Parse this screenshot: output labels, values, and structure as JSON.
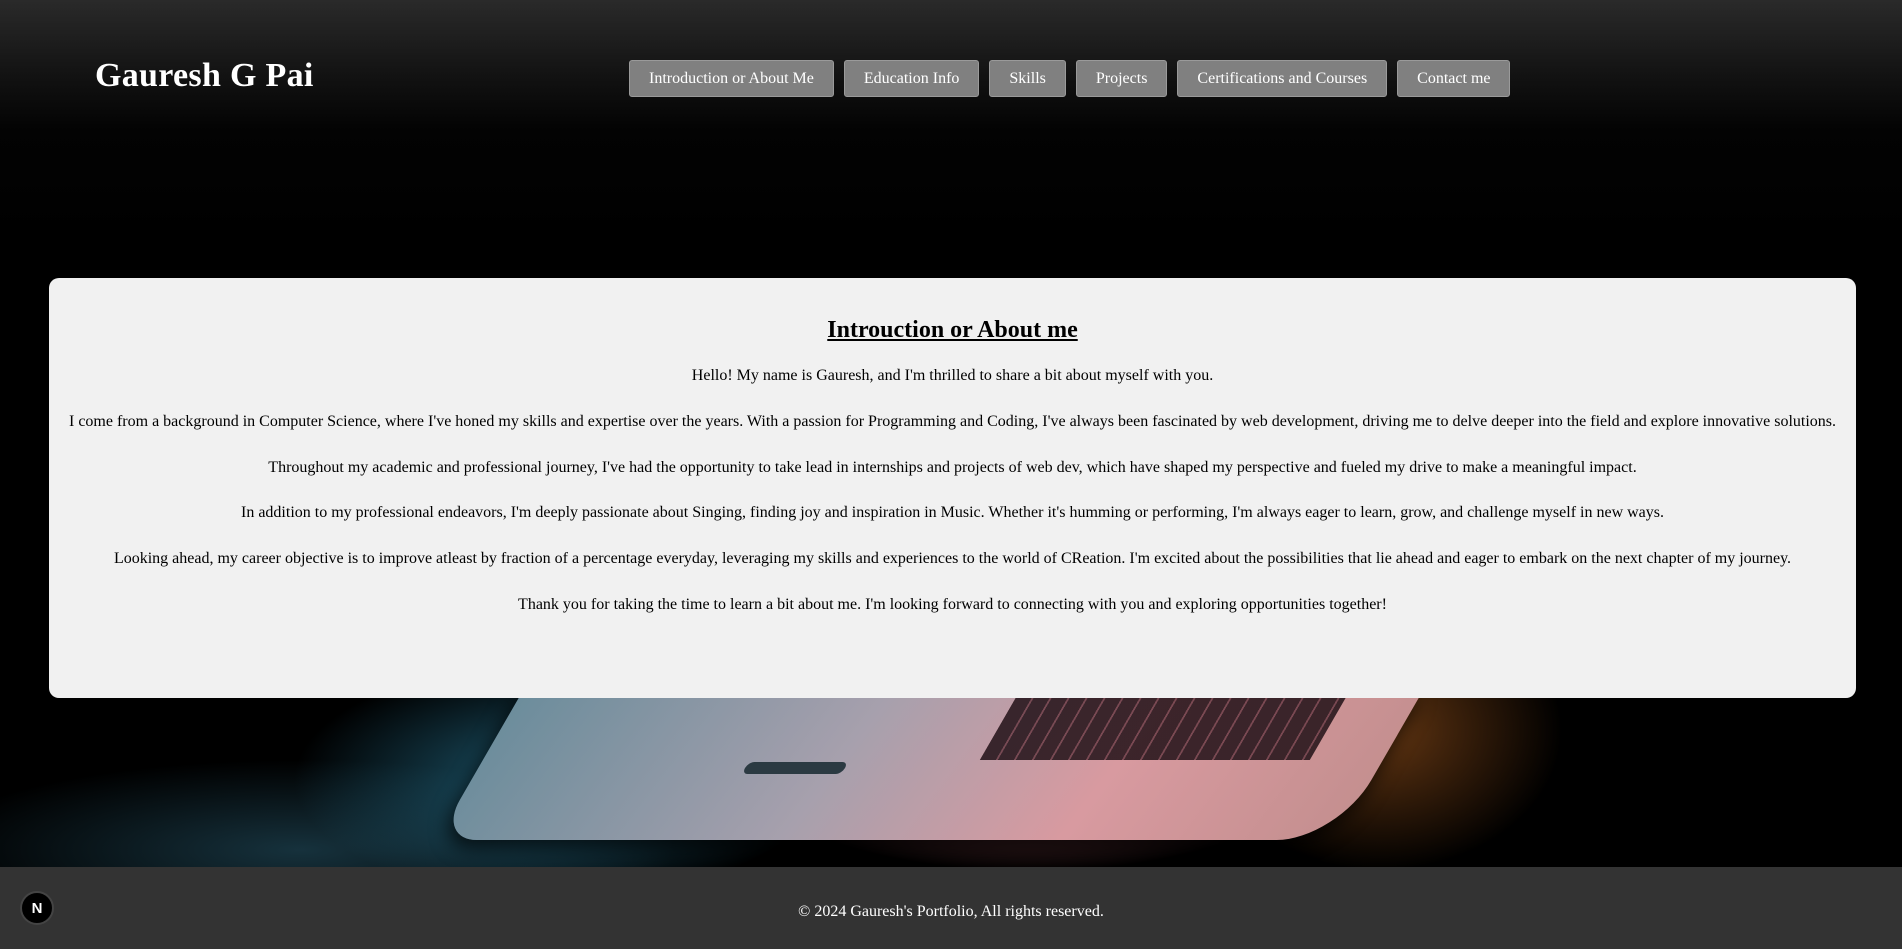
{
  "header": {
    "logo": "Gauresh G Pai",
    "nav": [
      {
        "label": "Introduction or About Me"
      },
      {
        "label": "Education Info"
      },
      {
        "label": "Skills"
      },
      {
        "label": "Projects"
      },
      {
        "label": "Certifications and Courses"
      },
      {
        "label": "Contact me"
      }
    ]
  },
  "about": {
    "title": "Introuction or About me",
    "paragraphs": [
      "Hello! My name is Gauresh, and I'm thrilled to share a bit about myself with you.",
      "I come from a background in Computer Science, where I've honed my skills and expertise over the years. With a passion for Programming and Coding, I've always been fascinated by web development, driving me to delve deeper into the field and explore innovative solutions.",
      "Throughout my academic and professional journey, I've had the opportunity to take lead in internships and projects of web dev, which have shaped my perspective and fueled my drive to make a meaningful impact.",
      "In addition to my professional endeavors, I'm deeply passionate about Singing, finding joy and inspiration in Music. Whether it's humming or performing, I'm always eager to learn, grow, and challenge myself in new ways.",
      "Looking ahead, my career objective is to improve atleast by fraction of a percentage everyday, leveraging my skills and experiences to the world of CReation. I'm excited about the possibilities that lie ahead and eager to embark on the next chapter of my journey.",
      "Thank you for taking the time to learn a bit about me. I'm looking forward to connecting with you and exploring opportunities together!"
    ]
  },
  "footer": {
    "text": "© 2024 Gauresh's Portfolio, All rights reserved.",
    "badge": "N"
  },
  "colors": {
    "nav_button_bg": "#808080",
    "card_bg": "#f1f1f1",
    "footer_bg": "#333333"
  }
}
